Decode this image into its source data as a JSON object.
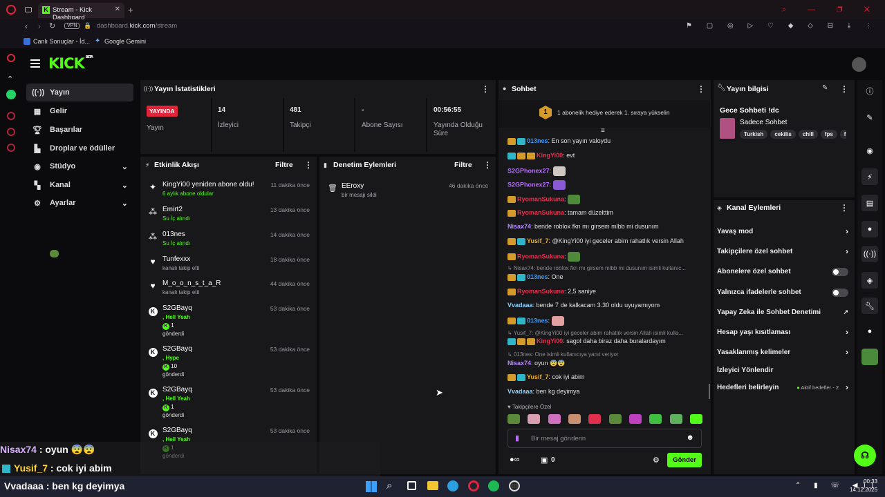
{
  "browser": {
    "tab_title": "Stream - Kick Dashboard",
    "url_domain": "dashboard.",
    "url_host": "kick.com",
    "url_path": "/stream",
    "vpn": "VPN",
    "bookmarks": [
      "Canlı Sonuçlar - İd...",
      "Google Gemini"
    ]
  },
  "brand": {
    "logo": "KICK",
    "beta": "BETA",
    "accent": "#53fc18"
  },
  "nav": [
    {
      "label": "Yayın",
      "icon": "radio-icon"
    },
    {
      "label": "Gelir",
      "icon": "money-icon"
    },
    {
      "label": "Başarılar",
      "icon": "trophy-icon"
    },
    {
      "label": "Droplar ve ödüller",
      "icon": "gift-icon"
    },
    {
      "label": "Stüdyo",
      "icon": "studio-icon"
    },
    {
      "label": "Kanal",
      "icon": "channel-icon"
    },
    {
      "label": "Ayarlar",
      "icon": "gear-icon"
    }
  ],
  "stats": {
    "title": "Yayın İstatistikleri",
    "live_badge": "YAYINDA",
    "live_label": "Yayın",
    "viewers": {
      "value": "14",
      "label": "İzleyici"
    },
    "followers": {
      "value": "481",
      "label": "Takipçi"
    },
    "subs": {
      "value": "-",
      "label": "Abone Sayısı"
    },
    "uptime": {
      "value": "00:56:55",
      "label": "Yayında Olduğu Süre"
    }
  },
  "activity": {
    "title": "Etkinlik Akışı",
    "filter": "Filtre",
    "items": [
      {
        "name": "KingYi00 yeniden abone oldu!",
        "time": "11 dakika önce",
        "sub": "6 aylık abone oldular",
        "icon": "sparkle-icon"
      },
      {
        "name": "Emirt2",
        "time": "13 dakika önce",
        "sub": "Su İç alındı",
        "icon": "points-icon"
      },
      {
        "name": "013nes",
        "time": "14 dakika önce",
        "sub": "Su İç alındı",
        "icon": "points-icon"
      },
      {
        "name": "Tunfexxx",
        "time": "18 dakika önce",
        "sub": "kanalı takip etti",
        "icon": "heart-icon"
      },
      {
        "name": "M_o_o_n_s_t_a_R",
        "time": "44 dakika önce",
        "sub": "kanalı takip etti",
        "icon": "heart-icon"
      },
      {
        "name": "S2GBayq",
        "time": "53 dakika önce",
        "sub1": ", Hell Yeah",
        "amount": "1",
        "sub2": "gönderdi",
        "icon": "kick-icon"
      },
      {
        "name": "S2GBayq",
        "time": "53 dakika önce",
        "sub1": ", Hype",
        "amount": "10",
        "sub2": "gönderdi",
        "icon": "kick-icon"
      },
      {
        "name": "S2GBayq",
        "time": "53 dakika önce",
        "sub1": ", Hell Yeah",
        "amount": "1",
        "sub2": "gönderdi",
        "icon": "kick-icon"
      },
      {
        "name": "S2GBayq",
        "time": "53 dakika önce",
        "sub1": ", Hell Yeah",
        "amount": "1",
        "sub2": "gönderdi",
        "icon": "kick-icon"
      }
    ]
  },
  "moderation": {
    "title": "Denetim Eylemleri",
    "filter": "Filtre",
    "item": {
      "name": "EEroxy",
      "sub": "bir mesajı sildi",
      "time": "46 dakika önce"
    }
  },
  "chat": {
    "title": "Sohbet",
    "pinned_num": "1",
    "pinned_text": "1 abonelik hediye ederek 1. sıraya yükselin",
    "lines": [
      {
        "user": "013nes",
        "color": "#3b9bff",
        "text": ": En son yayın valoydu",
        "badges": [
          "#d49a2a",
          "#2fb7c9"
        ]
      },
      {
        "user": "KingYi00",
        "color": "#e8304e",
        "text": ": evt",
        "badges": [
          "#2fb7c9",
          "#d49a2a",
          "#d49a2a"
        ]
      },
      {
        "user": "S2GPhonex27",
        "color": "#b76bff",
        "text": ":",
        "emote": "#cfc8c0",
        "badges": []
      },
      {
        "user": "S2GPhonex27",
        "color": "#b76bff",
        "text": ":",
        "emote": "#8a5ad6",
        "badges": []
      },
      {
        "user": "RyomanSukuna",
        "color": "#e8304e",
        "text": ":",
        "emote": "#4f8a3a",
        "badges": [
          "#d49a2a"
        ]
      },
      {
        "user": "RyomanSukuna",
        "color": "#e8304e",
        "text": ": tamam düzelttim",
        "badges": [
          "#d49a2a"
        ]
      },
      {
        "user": "Nisax74",
        "color": "#b98cff",
        "text": ": bende roblox fkn mı girsem mlbb mi dusunım",
        "badges": []
      },
      {
        "user": "Yusif_7",
        "color": "#f0b020",
        "text": ": @KingYi00 iyi geceler abim rahatlık versin Allah",
        "badges": [
          "#d49a2a",
          "#2fb7c9"
        ]
      },
      {
        "user": "RyomanSukuna",
        "color": "#e8304e",
        "text": ":",
        "emote": "#4f8a3a",
        "badges": [
          "#d49a2a"
        ]
      },
      {
        "reply": "Nisax74: bende roblox fkn mı girsem mlbb mi dusunım isimli kullanıc..."
      },
      {
        "user": "013nes",
        "color": "#3b9bff",
        "text": ": One",
        "badges": [
          "#d49a2a",
          "#2fb7c9"
        ]
      },
      {
        "user": "RyomanSukuna",
        "color": "#e8304e",
        "text": ": 2,5 saniye",
        "badges": [
          "#d49a2a"
        ]
      },
      {
        "user": "Vvadaaa",
        "color": "#8fd3ff",
        "text": ": bende 7 de kalkacam 3.30 oldu uyuyamıyom",
        "badges": []
      },
      {
        "user": "013nes",
        "color": "#3b9bff",
        "text": ":",
        "emote": "#e2a0a0",
        "badges": [
          "#d49a2a",
          "#2fb7c9"
        ]
      },
      {
        "reply": "Yusif_7: @KingYi00 iyi geceler abim rahatlık versin Allah isimli kulla..."
      },
      {
        "user": "KingYi00",
        "color": "#e8304e",
        "text": ": sagol daha biraz daha buralardayım",
        "badges": [
          "#2fb7c9",
          "#d49a2a",
          "#d49a2a"
        ]
      },
      {
        "reply": "013nes: One isimli kullanıcıya yanıt veriyor"
      },
      {
        "user": "Nisax74",
        "color": "#b98cff",
        "text": ": oyun 😨😨",
        "badges": []
      },
      {
        "user": "Yusif_7",
        "color": "#f0b020",
        "text": ": cok iyi abim",
        "badges": [
          "#d49a2a",
          "#2fb7c9"
        ]
      },
      {
        "user": "Vvadaaa",
        "color": "#8fd3ff",
        "text": ": ben kg deyimya",
        "badges": []
      }
    ],
    "followers_only": "Takipçilere Özel",
    "input_placeholder": "Bir mesaj gönderin",
    "points": "0",
    "send": "Gönder"
  },
  "info": {
    "title": "Yayın bilgisi",
    "stream_title": "Gece Sohbeti !dc",
    "category": "Sadece Sohbet",
    "tags": [
      "Turkish",
      "cekilis",
      "chill",
      "fps",
      "fi"
    ]
  },
  "channel_actions": {
    "title": "Kanal Eylemleri",
    "items": [
      {
        "label": "Yavaş mod",
        "right": "chevron"
      },
      {
        "label": "Takipçilere özel sohbet",
        "right": "chevron"
      },
      {
        "label": "Abonelere özel sohbet",
        "right": "toggle"
      },
      {
        "label": "Yalnızca ifadelerle sohbet",
        "right": "toggle"
      },
      {
        "label": "Yapay Zeka ile Sohbet Denetimi",
        "right": "external"
      },
      {
        "label": "Hesap yaşı kısıtlaması",
        "right": "chevron"
      },
      {
        "label": "Yasaklanmış kelimeler",
        "right": "chevron"
      },
      {
        "label": "İzleyici Yönlendir",
        "right": "none"
      },
      {
        "label": "Hedefleri belirleyin",
        "right": "chevron",
        "extra": "Aktif hedefler - 2"
      }
    ]
  },
  "overlay": [
    {
      "user": "Nisax74",
      "text": " : oyun 😨😨",
      "color": "#d9b3ff"
    },
    {
      "user": "Yusif_7",
      "text": " : cok iyi abim",
      "color": "#ffd23a"
    },
    {
      "user": "Vvadaaa",
      "text": " : ben kg deyimya",
      "color": "#ffffff"
    }
  ],
  "taskbar": {
    "time": "00:33",
    "date": "14.12.2025"
  }
}
